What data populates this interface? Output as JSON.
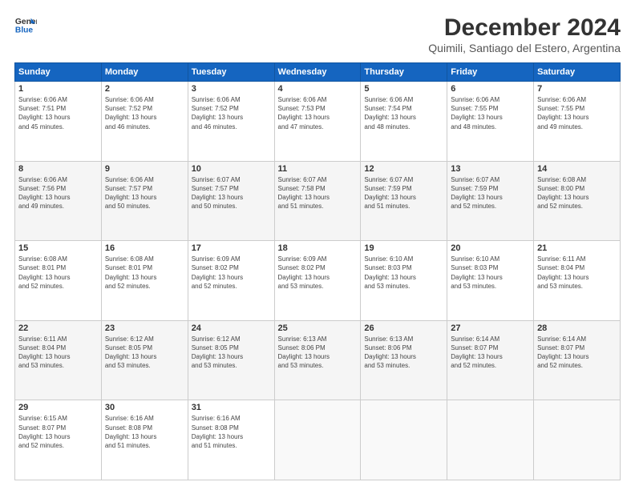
{
  "header": {
    "logo_line1": "General",
    "logo_line2": "Blue",
    "title": "December 2024",
    "subtitle": "Quimili, Santiago del Estero, Argentina"
  },
  "calendar": {
    "days_of_week": [
      "Sunday",
      "Monday",
      "Tuesday",
      "Wednesday",
      "Thursday",
      "Friday",
      "Saturday"
    ],
    "weeks": [
      [
        {
          "day": "1",
          "info": "Sunrise: 6:06 AM\nSunset: 7:51 PM\nDaylight: 13 hours\nand 45 minutes."
        },
        {
          "day": "2",
          "info": "Sunrise: 6:06 AM\nSunset: 7:52 PM\nDaylight: 13 hours\nand 46 minutes."
        },
        {
          "day": "3",
          "info": "Sunrise: 6:06 AM\nSunset: 7:52 PM\nDaylight: 13 hours\nand 46 minutes."
        },
        {
          "day": "4",
          "info": "Sunrise: 6:06 AM\nSunset: 7:53 PM\nDaylight: 13 hours\nand 47 minutes."
        },
        {
          "day": "5",
          "info": "Sunrise: 6:06 AM\nSunset: 7:54 PM\nDaylight: 13 hours\nand 48 minutes."
        },
        {
          "day": "6",
          "info": "Sunrise: 6:06 AM\nSunset: 7:55 PM\nDaylight: 13 hours\nand 48 minutes."
        },
        {
          "day": "7",
          "info": "Sunrise: 6:06 AM\nSunset: 7:55 PM\nDaylight: 13 hours\nand 49 minutes."
        }
      ],
      [
        {
          "day": "8",
          "info": "Sunrise: 6:06 AM\nSunset: 7:56 PM\nDaylight: 13 hours\nand 49 minutes."
        },
        {
          "day": "9",
          "info": "Sunrise: 6:06 AM\nSunset: 7:57 PM\nDaylight: 13 hours\nand 50 minutes."
        },
        {
          "day": "10",
          "info": "Sunrise: 6:07 AM\nSunset: 7:57 PM\nDaylight: 13 hours\nand 50 minutes."
        },
        {
          "day": "11",
          "info": "Sunrise: 6:07 AM\nSunset: 7:58 PM\nDaylight: 13 hours\nand 51 minutes."
        },
        {
          "day": "12",
          "info": "Sunrise: 6:07 AM\nSunset: 7:59 PM\nDaylight: 13 hours\nand 51 minutes."
        },
        {
          "day": "13",
          "info": "Sunrise: 6:07 AM\nSunset: 7:59 PM\nDaylight: 13 hours\nand 52 minutes."
        },
        {
          "day": "14",
          "info": "Sunrise: 6:08 AM\nSunset: 8:00 PM\nDaylight: 13 hours\nand 52 minutes."
        }
      ],
      [
        {
          "day": "15",
          "info": "Sunrise: 6:08 AM\nSunset: 8:01 PM\nDaylight: 13 hours\nand 52 minutes."
        },
        {
          "day": "16",
          "info": "Sunrise: 6:08 AM\nSunset: 8:01 PM\nDaylight: 13 hours\nand 52 minutes."
        },
        {
          "day": "17",
          "info": "Sunrise: 6:09 AM\nSunset: 8:02 PM\nDaylight: 13 hours\nand 52 minutes."
        },
        {
          "day": "18",
          "info": "Sunrise: 6:09 AM\nSunset: 8:02 PM\nDaylight: 13 hours\nand 53 minutes."
        },
        {
          "day": "19",
          "info": "Sunrise: 6:10 AM\nSunset: 8:03 PM\nDaylight: 13 hours\nand 53 minutes."
        },
        {
          "day": "20",
          "info": "Sunrise: 6:10 AM\nSunset: 8:03 PM\nDaylight: 13 hours\nand 53 minutes."
        },
        {
          "day": "21",
          "info": "Sunrise: 6:11 AM\nSunset: 8:04 PM\nDaylight: 13 hours\nand 53 minutes."
        }
      ],
      [
        {
          "day": "22",
          "info": "Sunrise: 6:11 AM\nSunset: 8:04 PM\nDaylight: 13 hours\nand 53 minutes."
        },
        {
          "day": "23",
          "info": "Sunrise: 6:12 AM\nSunset: 8:05 PM\nDaylight: 13 hours\nand 53 minutes."
        },
        {
          "day": "24",
          "info": "Sunrise: 6:12 AM\nSunset: 8:05 PM\nDaylight: 13 hours\nand 53 minutes."
        },
        {
          "day": "25",
          "info": "Sunrise: 6:13 AM\nSunset: 8:06 PM\nDaylight: 13 hours\nand 53 minutes."
        },
        {
          "day": "26",
          "info": "Sunrise: 6:13 AM\nSunset: 8:06 PM\nDaylight: 13 hours\nand 53 minutes."
        },
        {
          "day": "27",
          "info": "Sunrise: 6:14 AM\nSunset: 8:07 PM\nDaylight: 13 hours\nand 52 minutes."
        },
        {
          "day": "28",
          "info": "Sunrise: 6:14 AM\nSunset: 8:07 PM\nDaylight: 13 hours\nand 52 minutes."
        }
      ],
      [
        {
          "day": "29",
          "info": "Sunrise: 6:15 AM\nSunset: 8:07 PM\nDaylight: 13 hours\nand 52 minutes."
        },
        {
          "day": "30",
          "info": "Sunrise: 6:16 AM\nSunset: 8:08 PM\nDaylight: 13 hours\nand 51 minutes."
        },
        {
          "day": "31",
          "info": "Sunrise: 6:16 AM\nSunset: 8:08 PM\nDaylight: 13 hours\nand 51 minutes."
        },
        {
          "day": "",
          "info": ""
        },
        {
          "day": "",
          "info": ""
        },
        {
          "day": "",
          "info": ""
        },
        {
          "day": "",
          "info": ""
        }
      ]
    ]
  }
}
